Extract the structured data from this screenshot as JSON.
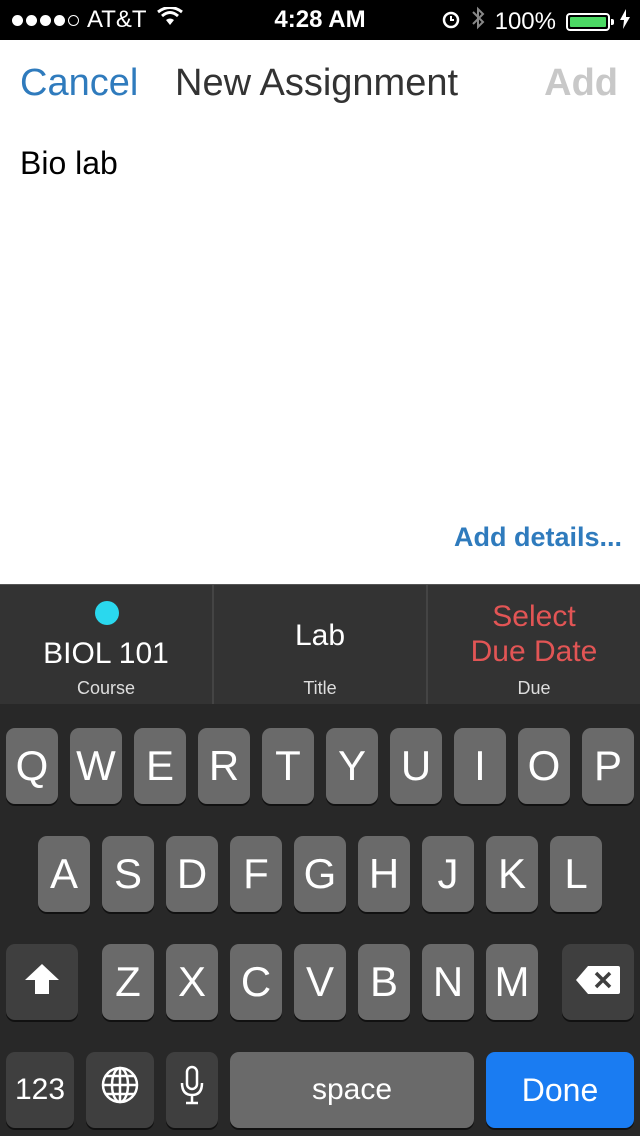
{
  "status_bar": {
    "carrier": "AT&T",
    "time": "4:28 AM",
    "battery": "100%"
  },
  "nav": {
    "cancel": "Cancel",
    "title": "New Assignment",
    "add": "Add"
  },
  "content": {
    "text": "Bio lab",
    "add_details": "Add details..."
  },
  "accessory": {
    "course": {
      "value": "BIOL 101",
      "caption": "Course",
      "dot_color": "#2ad8ee"
    },
    "title": {
      "value": "Lab",
      "caption": "Title"
    },
    "due": {
      "line1": "Select",
      "line2": "Due Date",
      "caption": "Due",
      "color": "#e25555"
    }
  },
  "keyboard": {
    "row1": [
      "Q",
      "W",
      "E",
      "R",
      "T",
      "Y",
      "U",
      "I",
      "O",
      "P"
    ],
    "row2": [
      "A",
      "S",
      "D",
      "F",
      "G",
      "H",
      "J",
      "K",
      "L"
    ],
    "row3": [
      "Z",
      "X",
      "C",
      "V",
      "B",
      "N",
      "M"
    ],
    "numbers": "123",
    "space": "space",
    "done": "Done",
    "icons": [
      "shift-icon",
      "delete-icon",
      "globe-icon",
      "microphone-icon"
    ]
  }
}
